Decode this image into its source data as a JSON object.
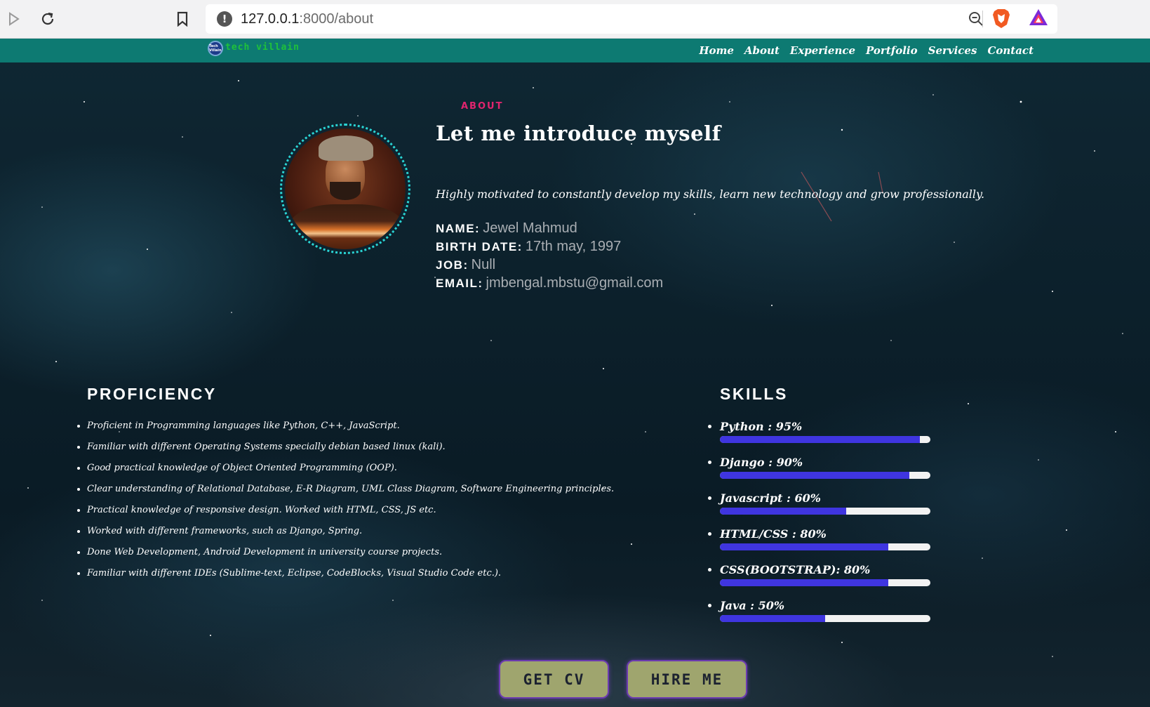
{
  "browser": {
    "url_host": "127.0.0.1",
    "url_path": ":8000/about"
  },
  "navbar": {
    "brand": "tech villain",
    "logo_text": "Tech Villain",
    "links": [
      "Home",
      "About",
      "Experience",
      "Portfolio",
      "Services",
      "Contact"
    ]
  },
  "about": {
    "label": "ABOUT",
    "title": "Let me introduce myself",
    "tagline": "Highly motivated to constantly develop my skills, learn new technology and grow professionally.",
    "info": [
      {
        "key": "NAME:",
        "value": "Jewel Mahmud"
      },
      {
        "key": "BIRTH DATE:",
        "value": "17th may, 1997"
      },
      {
        "key": "JOB:",
        "value": "Null"
      },
      {
        "key": "EMAIL:",
        "value": "jmbengal.mbstu@gmail.com"
      }
    ]
  },
  "proficiency": {
    "heading": "PROFICIENCY",
    "items": [
      "Proficient in Programming languages like Python, C++, JavaScript.",
      "Familiar with different Operating Systems specially debian based linux (kali).",
      "Good practical knowledge of Object Oriented Programming (OOP).",
      "Clear understanding of Relational Database, E-R Diagram, UML Class Diagram, Software Engineering principles.",
      "Practical knowledge of responsive design. Worked with HTML, CSS, JS etc.",
      "Worked with different frameworks, such as Django, Spring.",
      "Done Web Development, Android Development in university course projects.",
      "Familiar with different IDEs (Sublime-text, Eclipse, CodeBlocks, Visual Studio Code etc.)."
    ]
  },
  "skills": {
    "heading": "SKILLS",
    "items": [
      {
        "label": "Python : 95%",
        "percent": 95
      },
      {
        "label": "Django : 90%",
        "percent": 90
      },
      {
        "label": "Javascript : 60%",
        "percent": 60
      },
      {
        "label": "HTML/CSS : 80%",
        "percent": 80
      },
      {
        "label": "CSS(BOOTSTRAP): 80%",
        "percent": 80
      },
      {
        "label": "Java : 50%",
        "percent": 50
      }
    ],
    "bar_color": "#3f35e0"
  },
  "buttons": {
    "cv": "GET CV",
    "hire": "HIRE ME"
  },
  "colors": {
    "navbar": "#0d7a72",
    "about_label": "#e0246e",
    "button_bg": "#9fa56e"
  }
}
